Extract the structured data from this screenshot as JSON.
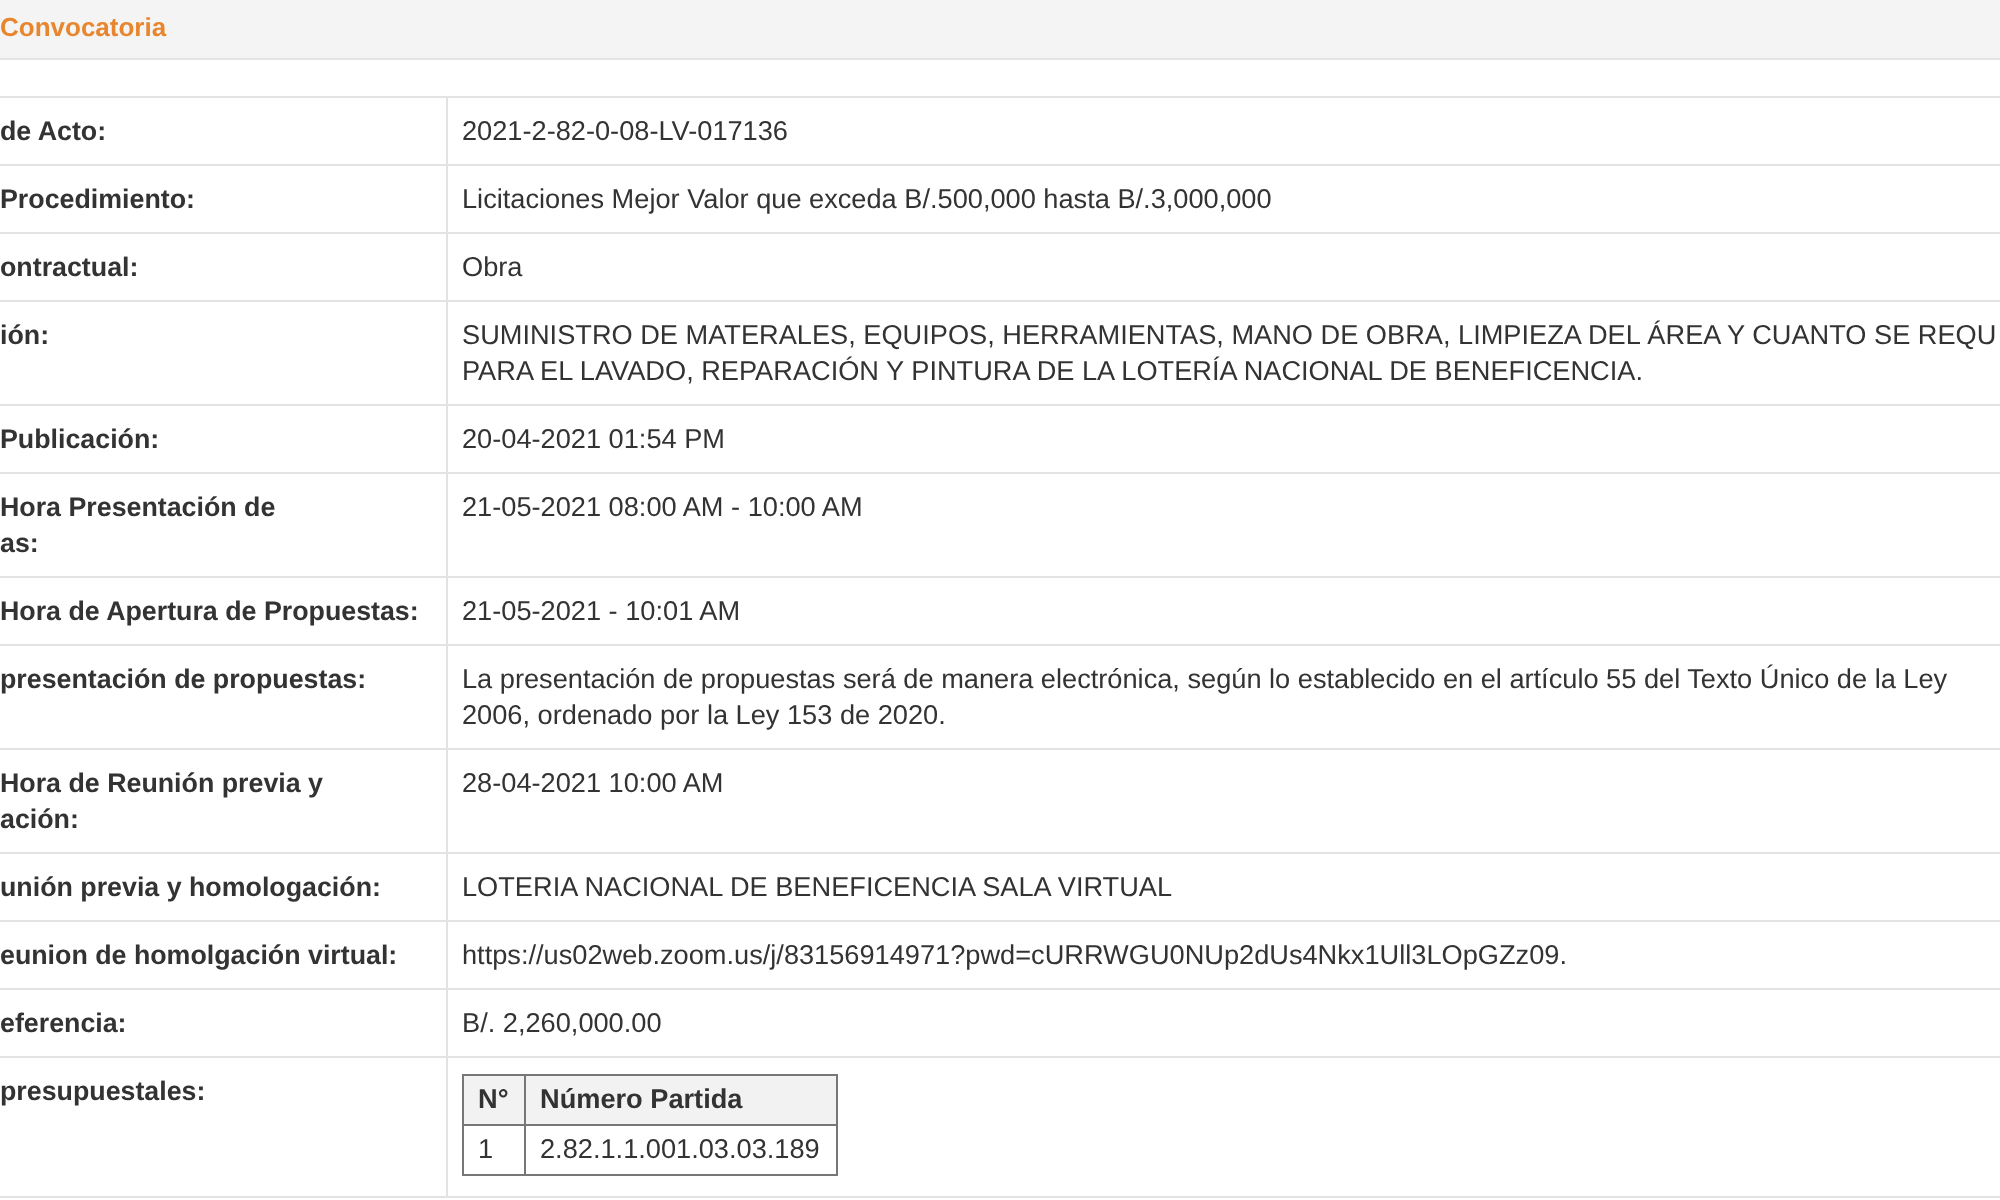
{
  "panel": {
    "title": "Convocatoria"
  },
  "rows": [
    {
      "kind": "text",
      "label": "de Acto:",
      "value": "2021-2-82-0-08-LV-017136"
    },
    {
      "kind": "text",
      "label": "Procedimiento:",
      "value": "Licitaciones Mejor Valor que exceda B/.500,000 hasta B/.3,000,000"
    },
    {
      "kind": "text",
      "label": "ontractual:",
      "value": "Obra"
    },
    {
      "kind": "text",
      "label": "ión:",
      "value": "SUMINISTRO DE MATERALES, EQUIPOS, HERRAMIENTAS, MANO DE OBRA, LIMPIEZA DEL ÁREA Y CUANTO SE REQU\nPARA EL LAVADO, REPARACIÓN Y PINTURA DE LA LOTERÍA NACIONAL DE BENEFICENCIA."
    },
    {
      "kind": "text",
      "label": "Publicación:",
      "value": "20-04-2021 01:54 PM"
    },
    {
      "kind": "text",
      "label": "Hora Presentación de\nas:",
      "value": "21-05-2021 08:00 AM - 10:00 AM"
    },
    {
      "kind": "text",
      "label": "Hora de Apertura de Propuestas:",
      "value": "21-05-2021 - 10:01 AM"
    },
    {
      "kind": "text",
      "label": "presentación de propuestas:",
      "value": "La presentación de propuestas será de manera electrónica, según lo establecido en el artículo 55 del Texto Único de la Ley\n2006, ordenado por la Ley 153 de 2020."
    },
    {
      "kind": "text",
      "label": "Hora de Reunión previa y\nación:",
      "value": "28-04-2021 10:00 AM"
    },
    {
      "kind": "text",
      "label": "unión previa y homologación:",
      "value": "LOTERIA NACIONAL DE BENEFICENCIA SALA VIRTUAL"
    },
    {
      "kind": "text",
      "label": "eunion de homolgación virtual:",
      "value": "https://us02web.zoom.us/j/83156914971?pwd=cURRWGU0NUp2dUs4Nkx1Ull3LOpGZz09."
    },
    {
      "kind": "text",
      "label": "eferencia:",
      "value": "B/. 2,260,000.00"
    },
    {
      "kind": "table",
      "label": "presupuestales:",
      "table": {
        "columns": [
          "N°",
          "Número Partida"
        ],
        "rows": [
          [
            "1",
            "2.82.1.1.001.03.03.189"
          ]
        ]
      }
    }
  ]
}
